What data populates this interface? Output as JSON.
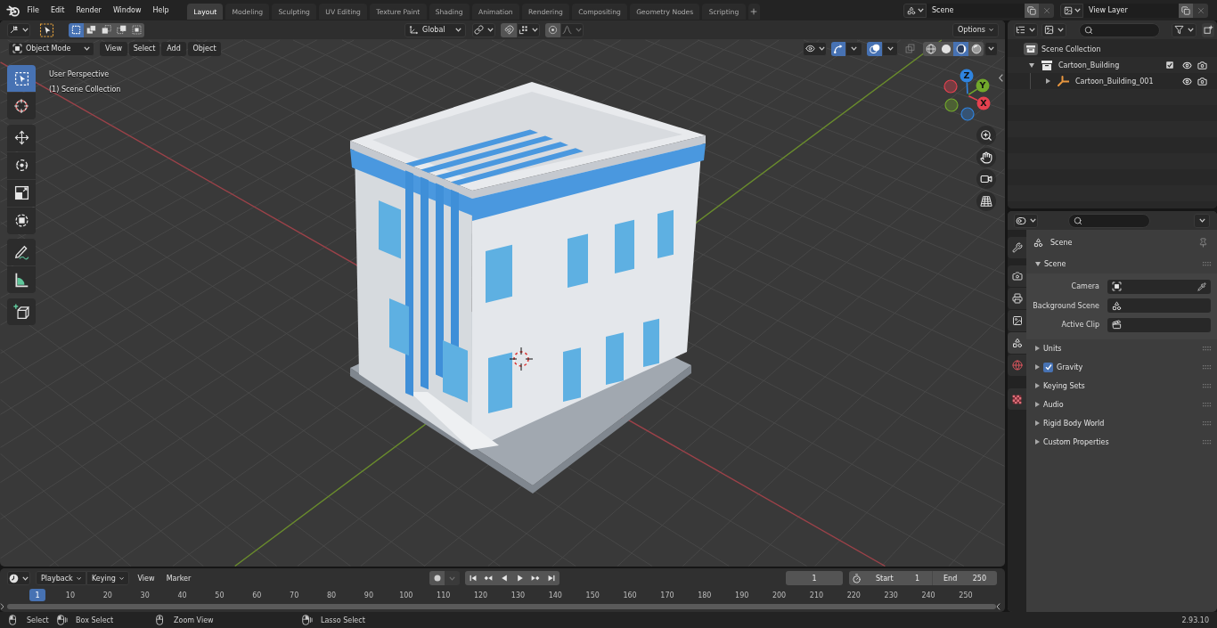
{
  "top_bar": {
    "menus": [
      "File",
      "Edit",
      "Render",
      "Window",
      "Help"
    ],
    "workspaces": [
      {
        "label": "Layout",
        "selected": true
      },
      {
        "label": "Modeling",
        "selected": false
      },
      {
        "label": "Sculpting",
        "selected": false
      },
      {
        "label": "UV Editing",
        "selected": false
      },
      {
        "label": "Texture Paint",
        "selected": false
      },
      {
        "label": "Shading",
        "selected": false
      },
      {
        "label": "Animation",
        "selected": false
      },
      {
        "label": "Rendering",
        "selected": false
      },
      {
        "label": "Compositing",
        "selected": false
      },
      {
        "label": "Geometry Nodes",
        "selected": false
      },
      {
        "label": "Scripting",
        "selected": false
      }
    ],
    "scene": "Scene",
    "view_layer": "View Layer"
  },
  "viewport": {
    "select_modes": [
      {
        "kind": "set",
        "selected": true
      },
      {
        "kind": "extend",
        "selected": false
      },
      {
        "kind": "subtract",
        "selected": false
      },
      {
        "kind": "invert",
        "selected": false
      },
      {
        "kind": "intersect",
        "selected": false
      }
    ],
    "orientation": "Global",
    "options": "Options",
    "mode": "Object Mode",
    "menus": [
      "View",
      "Select",
      "Add",
      "Object"
    ],
    "gizmos": true,
    "overlays": true,
    "shading_modes": [
      {
        "kind": "wireframe",
        "selected": false
      },
      {
        "kind": "solid",
        "selected": false
      },
      {
        "kind": "material",
        "selected": true
      },
      {
        "kind": "rendered",
        "selected": false
      }
    ],
    "info": [
      "User Perspective",
      "(1) Scene Collection"
    ],
    "tool_groups": [
      [
        {
          "kind": "select_box",
          "selected": true
        },
        {
          "kind": "cursor",
          "selected": false
        }
      ],
      [
        {
          "kind": "move",
          "selected": false
        },
        {
          "kind": "rotate",
          "selected": false
        },
        {
          "kind": "scale",
          "selected": false
        },
        {
          "kind": "transform",
          "selected": false
        }
      ],
      [
        {
          "kind": "annotate",
          "selected": false
        },
        {
          "kind": "measure",
          "selected": false
        }
      ],
      [
        {
          "kind": "add_cube",
          "selected": false
        }
      ]
    ],
    "gizmo_axes": [
      {
        "label": "Z",
        "color": "#2f84e0"
      },
      {
        "label": "Y",
        "color": "#72a82b"
      },
      {
        "label": "X",
        "color": "#e5414f"
      }
    ]
  },
  "timeline": {
    "menus": [
      {
        "kind": "dropdown",
        "label": "Playback"
      },
      {
        "kind": "dropdown",
        "label": "Keying"
      },
      {
        "kind": "menu",
        "label": "View"
      },
      {
        "kind": "menu",
        "label": "Marker"
      }
    ],
    "auto_keying": false,
    "current_frame": "1",
    "start": {
      "label": "Start",
      "value": "1"
    },
    "end": {
      "label": "End",
      "value": "250"
    },
    "playhead": "1",
    "ticks": [
      "10",
      "20",
      "30",
      "40",
      "50",
      "60",
      "70",
      "80",
      "90",
      "100",
      "110",
      "120",
      "130",
      "140",
      "150",
      "160",
      "170",
      "180",
      "190",
      "200",
      "210",
      "220",
      "230",
      "240",
      "250"
    ]
  },
  "outliner": {
    "tree": [
      {
        "kind": "scene_collection",
        "label": "Scene Collection",
        "children": [
          {
            "kind": "collection",
            "label": "Cartoon_Building",
            "expanded": true,
            "checked": true,
            "children": [
              {
                "kind": "empty",
                "label": "Cartoon_Building_001",
                "expanded": false
              }
            ]
          }
        ]
      }
    ]
  },
  "properties": {
    "tab_groups": [
      [
        {
          "kind": "tool",
          "selected": false
        }
      ],
      [
        {
          "kind": "render",
          "selected": false
        },
        {
          "kind": "output",
          "selected": false
        },
        {
          "kind": "view_layer",
          "selected": false
        },
        {
          "kind": "scene",
          "selected": true
        },
        {
          "kind": "world",
          "selected": false
        }
      ],
      [
        {
          "kind": "texture",
          "selected": false
        }
      ]
    ],
    "context": "Scene",
    "panels": [
      {
        "title": "Scene",
        "expanded": true,
        "fields": [
          {
            "kind": "object",
            "label": "Camera"
          },
          {
            "kind": "scene",
            "label": "Background Scene"
          },
          {
            "kind": "clip",
            "label": "Active Clip"
          }
        ]
      },
      {
        "title": "Units",
        "expanded": false
      },
      {
        "title": "Gravity",
        "expanded": false,
        "checked": true
      },
      {
        "title": "Keying Sets",
        "expanded": false
      },
      {
        "title": "Audio",
        "expanded": false
      },
      {
        "title": "Rigid Body World",
        "expanded": false
      },
      {
        "title": "Custom Properties",
        "expanded": false
      }
    ]
  },
  "status_bar": {
    "hints": [
      {
        "kind": "left_click",
        "label": "Select"
      },
      {
        "kind": "left_drag",
        "label": "Box Select"
      },
      {
        "kind": "middle_click",
        "label": "Zoom View"
      },
      {
        "kind": "right_drag",
        "label": "Lasso Select"
      }
    ],
    "version": "2.93.10"
  }
}
